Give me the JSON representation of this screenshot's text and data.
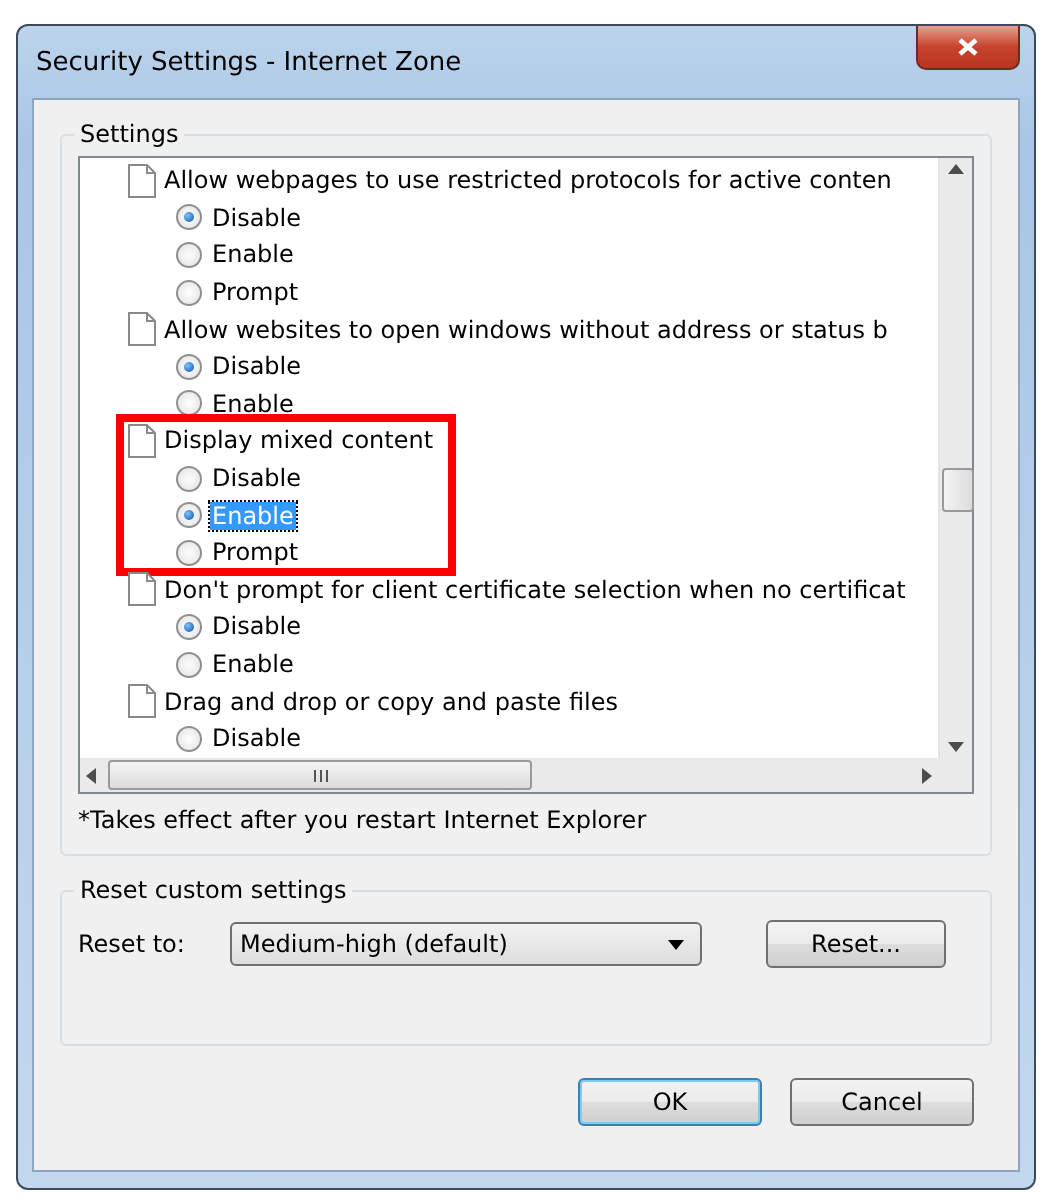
{
  "window": {
    "title": "Security Settings - Internet Zone"
  },
  "settings": {
    "legend": "Settings",
    "groups": [
      {
        "heading": "Allow webpages to use restricted protocols for active conten",
        "highlighted": false,
        "options": [
          {
            "label": "Disable",
            "selected": true,
            "focused": false
          },
          {
            "label": "Enable",
            "selected": false,
            "focused": false
          },
          {
            "label": "Prompt",
            "selected": false,
            "focused": false
          }
        ]
      },
      {
        "heading": "Allow websites to open windows without address or status b",
        "highlighted": false,
        "options": [
          {
            "label": "Disable",
            "selected": true,
            "focused": false
          },
          {
            "label": "Enable",
            "selected": false,
            "focused": false
          }
        ]
      },
      {
        "heading": "Display mixed content",
        "highlighted": true,
        "options": [
          {
            "label": "Disable",
            "selected": false,
            "focused": false
          },
          {
            "label": "Enable",
            "selected": true,
            "focused": true
          },
          {
            "label": "Prompt",
            "selected": false,
            "focused": false
          }
        ]
      },
      {
        "heading": "Don't prompt for client certificate selection when no certificat",
        "highlighted": false,
        "options": [
          {
            "label": "Disable",
            "selected": true,
            "focused": false
          },
          {
            "label": "Enable",
            "selected": false,
            "focused": false
          }
        ]
      },
      {
        "heading": "Drag and drop or copy and paste files",
        "highlighted": false,
        "options": [
          {
            "label": "Disable",
            "selected": false,
            "focused": false
          }
        ]
      }
    ],
    "note": "*Takes effect after you restart Internet Explorer"
  },
  "reset": {
    "legend": "Reset custom settings",
    "label": "Reset to:",
    "value": "Medium-high (default)",
    "button": "Reset..."
  },
  "buttons": [
    {
      "label": "OK",
      "default": true
    },
    {
      "label": "Cancel",
      "default": false
    }
  ]
}
